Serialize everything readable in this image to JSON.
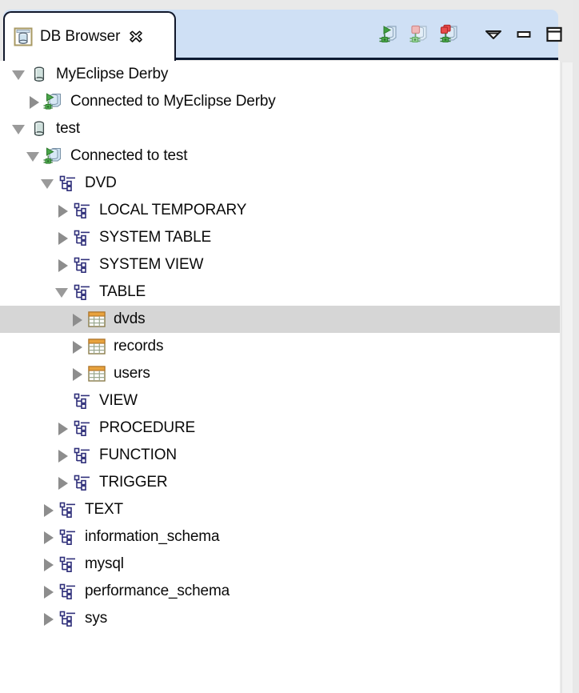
{
  "colors": {
    "tabstrip_bg": "#cfe0f5",
    "tab_active_bg": "#ffffff",
    "tab_border": "#11182b",
    "tree_bg": "#ffffff",
    "selection_bg": "#d6d6d6",
    "text": "#0a0a0a",
    "twisty_gray": "#8d8d8d",
    "schema_icon": "#2f2f7a",
    "table_icon_header": "#e8a33d",
    "connect_green": "#3f9e3f",
    "disconnect_red": "#d83a3a"
  },
  "tab": {
    "label": "DB Browser",
    "icon": "database-cylinder-icon",
    "close_icon": "close-icon",
    "active": true
  },
  "toolbar": {
    "buttons": [
      {
        "name": "connect-button",
        "icon": "database-connect-icon",
        "title": "Connect",
        "enabled": true
      },
      {
        "name": "disconnect-button",
        "icon": "database-disconnect-icon",
        "title": "Disconnect",
        "enabled": false
      },
      {
        "name": "disconnect-all-button",
        "icon": "database-disconnect-all-icon",
        "title": "Disconnect All",
        "enabled": true
      },
      {
        "name": "view-menu-button",
        "icon": "chevron-down-icon",
        "title": "View Menu",
        "enabled": true
      },
      {
        "name": "minimize-button",
        "icon": "minimize-icon",
        "title": "Minimize",
        "enabled": true
      },
      {
        "name": "maximize-button",
        "icon": "maximize-icon",
        "title": "Maximize",
        "enabled": true
      }
    ]
  },
  "tree": {
    "rows": [
      {
        "label": "MyEclipse Derby",
        "depth": 0,
        "state": "expanded",
        "icon": "database-cylinder-icon",
        "selected": false
      },
      {
        "label": "Connected to MyEclipse Derby",
        "depth": 1,
        "state": "collapsed",
        "icon": "database-connected-icon",
        "selected": false
      },
      {
        "label": "test",
        "depth": 0,
        "state": "expanded",
        "icon": "database-cylinder-icon",
        "selected": false
      },
      {
        "label": "Connected to test",
        "depth": 1,
        "state": "expanded",
        "icon": "database-connected-icon",
        "selected": false
      },
      {
        "label": "DVD",
        "depth": 2,
        "state": "expanded",
        "icon": "schema-icon",
        "selected": false
      },
      {
        "label": "LOCAL TEMPORARY",
        "depth": 3,
        "state": "collapsed",
        "icon": "schema-icon",
        "selected": false
      },
      {
        "label": "SYSTEM TABLE",
        "depth": 3,
        "state": "collapsed",
        "icon": "schema-icon",
        "selected": false
      },
      {
        "label": "SYSTEM VIEW",
        "depth": 3,
        "state": "collapsed",
        "icon": "schema-icon",
        "selected": false
      },
      {
        "label": "TABLE",
        "depth": 3,
        "state": "expanded",
        "icon": "schema-icon",
        "selected": false
      },
      {
        "label": "dvds",
        "depth": 4,
        "state": "collapsed",
        "icon": "table-icon",
        "selected": true
      },
      {
        "label": "records",
        "depth": 4,
        "state": "collapsed",
        "icon": "table-icon",
        "selected": false
      },
      {
        "label": "users",
        "depth": 4,
        "state": "collapsed",
        "icon": "table-icon",
        "selected": false
      },
      {
        "label": "VIEW",
        "depth": 3,
        "state": "leaf",
        "icon": "schema-icon",
        "selected": false
      },
      {
        "label": "PROCEDURE",
        "depth": 3,
        "state": "collapsed",
        "icon": "schema-icon",
        "selected": false
      },
      {
        "label": "FUNCTION",
        "depth": 3,
        "state": "collapsed",
        "icon": "schema-icon",
        "selected": false
      },
      {
        "label": "TRIGGER",
        "depth": 3,
        "state": "collapsed",
        "icon": "schema-icon",
        "selected": false
      },
      {
        "label": "TEXT",
        "depth": 2,
        "state": "collapsed",
        "icon": "schema-icon",
        "selected": false
      },
      {
        "label": "information_schema",
        "depth": 2,
        "state": "collapsed",
        "icon": "schema-icon",
        "selected": false
      },
      {
        "label": "mysql",
        "depth": 2,
        "state": "collapsed",
        "icon": "schema-icon",
        "selected": false
      },
      {
        "label": "performance_schema",
        "depth": 2,
        "state": "collapsed",
        "icon": "schema-icon",
        "selected": false
      },
      {
        "label": "sys",
        "depth": 2,
        "state": "collapsed",
        "icon": "schema-icon",
        "selected": false
      }
    ]
  }
}
